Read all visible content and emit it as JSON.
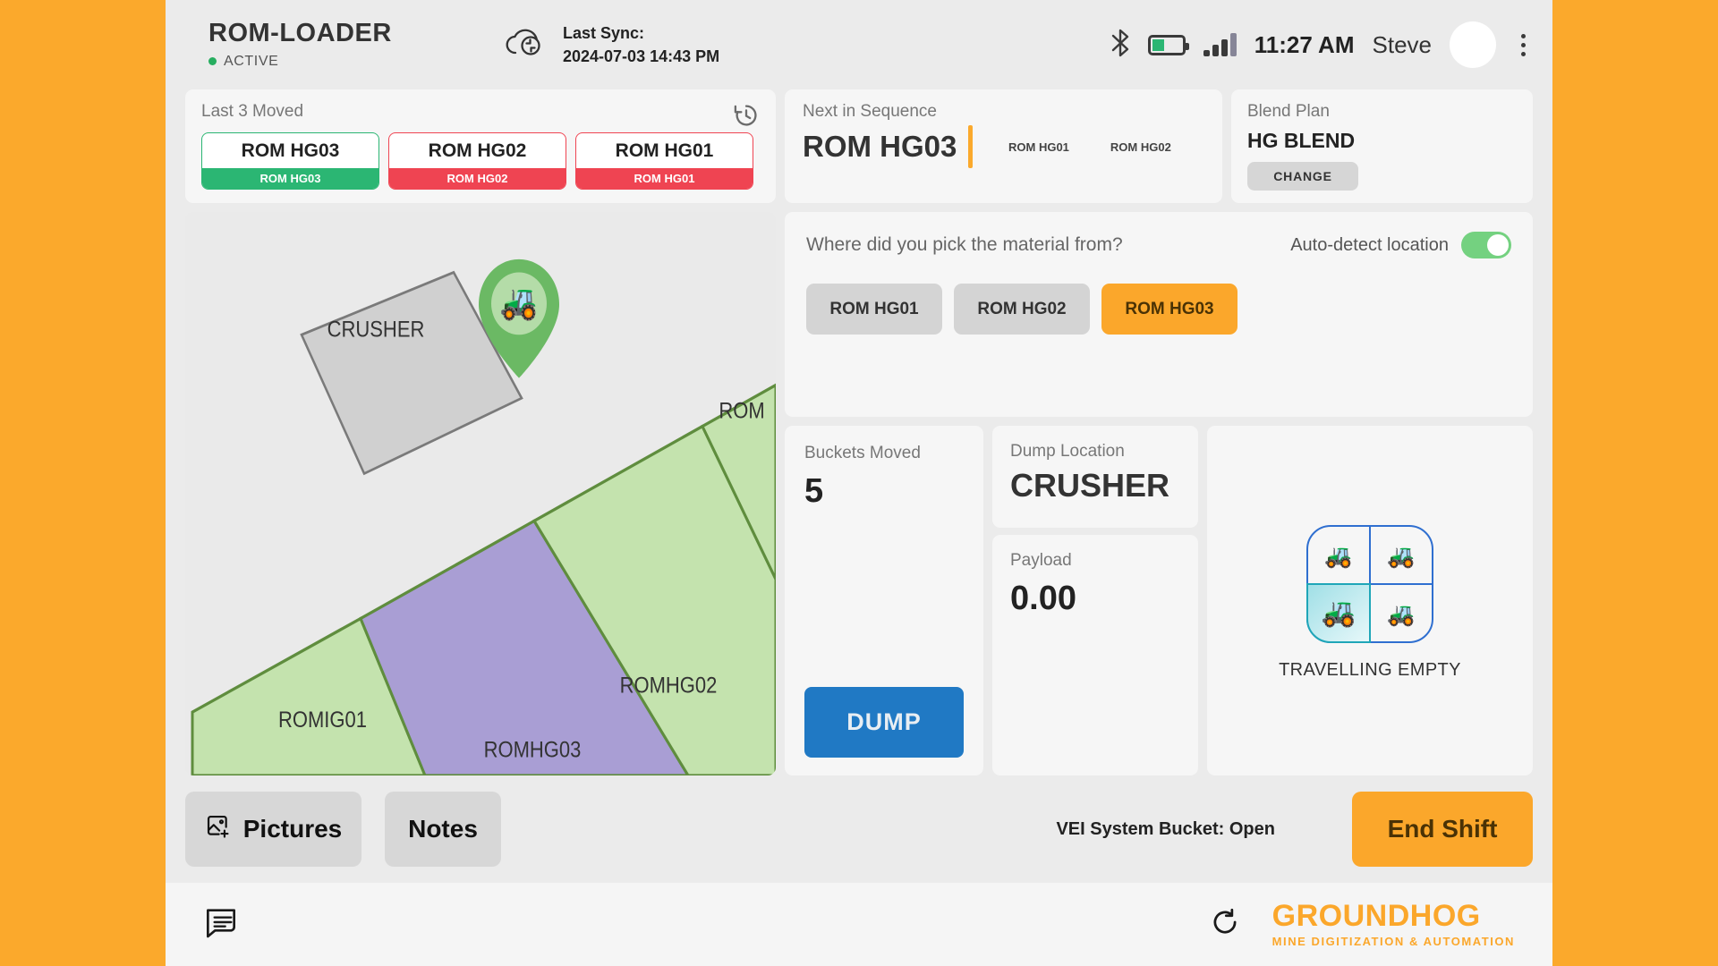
{
  "header": {
    "brand_title": "ROM-LOADER",
    "brand_status": "ACTIVE",
    "sync_label": "Last Sync:",
    "sync_value": "2024-07-03 14:43 PM",
    "time": "11:27 AM",
    "user": "Steve",
    "icons": {
      "sync": "cloud-sync-icon",
      "bluetooth": "bluetooth-icon",
      "battery": "battery-icon",
      "signal": "signal-bars-icon",
      "avatar": "avatar",
      "menu": "kebab-menu-icon"
    },
    "battery_level_pct": 47,
    "signal_bars": 4,
    "signal_bars_active": 3
  },
  "last_moved": {
    "title": "Last 3 Moved",
    "history_icon": "history-icon",
    "items": [
      {
        "name": "ROM HG03",
        "sub": "ROM HG03",
        "status": "green"
      },
      {
        "name": "ROM HG02",
        "sub": "ROM HG02",
        "status": "red"
      },
      {
        "name": "ROM HG01",
        "sub": "ROM HG01",
        "status": "red"
      }
    ]
  },
  "next_in_sequence": {
    "title": "Next in Sequence",
    "current": "ROM HG03",
    "queue": [
      "ROM HG01",
      "ROM HG02"
    ]
  },
  "blend_plan": {
    "title": "Blend Plan",
    "value": "HG BLEND",
    "change_label": "CHANGE"
  },
  "map": {
    "crusher_label": "CRUSHER",
    "zones": [
      {
        "label": "ROMIG01",
        "color": "#c4e3ae"
      },
      {
        "label": "ROMHG03",
        "color": "#a99ed4"
      },
      {
        "label": "ROMHG02",
        "color": "#c4e3ae"
      },
      {
        "label": "ROM",
        "color": "#c4e3ae"
      }
    ],
    "marker_icon": "loader-map-pin-icon",
    "stroke_color": "#5f8d3e"
  },
  "source": {
    "question": "Where did you pick the material from?",
    "autodetect_label": "Auto-detect location",
    "autodetect_on": true,
    "options": [
      "ROM HG01",
      "ROM HG02",
      "ROM HG03"
    ],
    "selected": "ROM HG03",
    "accent": "#FBA72B"
  },
  "stats": {
    "buckets_label": "Buckets Moved",
    "buckets_value": "5",
    "dump_label": "DUMP",
    "dump_location_label": "Dump Location",
    "dump_location_value": "CRUSHER",
    "payload_label": "Payload",
    "payload_value": "0.00",
    "dump_color": "#2079c4"
  },
  "vehicle_state": {
    "label": "TRAVELLING EMPTY",
    "active_quadrant": "bottom-left",
    "quadrants": [
      "loading-icon",
      "travelling-loaded-icon",
      "travelling-empty-icon",
      "dumping-icon"
    ]
  },
  "actions": {
    "pictures_label": "Pictures",
    "pictures_icon": "add-image-icon",
    "notes_label": "Notes",
    "vei_status": "VEI System Bucket: Open",
    "end_shift_label": "End Shift"
  },
  "footer": {
    "chat_icon": "message-icon",
    "refresh_icon": "refresh-icon",
    "logo_word": "GROUNDHOG",
    "logo_tagline": "MINE DIGITIZATION & AUTOMATION"
  }
}
